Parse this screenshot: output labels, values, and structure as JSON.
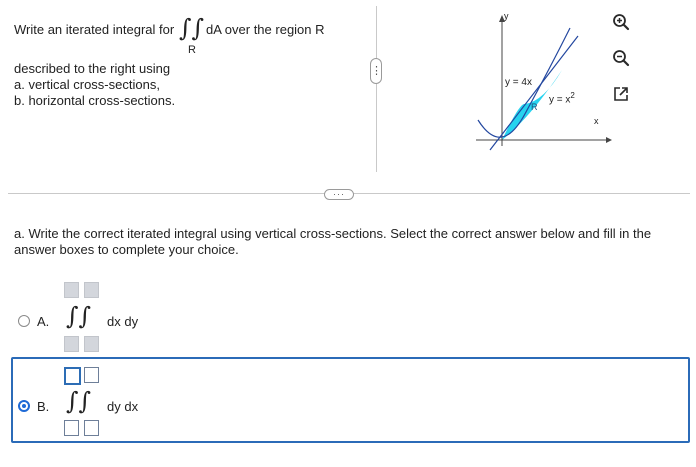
{
  "problem": {
    "intro": "Write an iterated integral for",
    "integrand": "dA over the region R",
    "region_sub": "R",
    "line2": "described to the right using",
    "line3": "a. vertical cross-sections,",
    "line4": "b. horizontal cross-sections."
  },
  "graph": {
    "y_axis": "y",
    "x_axis": "x",
    "line_label": "y = 4x",
    "curve_label_base": "y = x",
    "curve_label_exp": "2",
    "region_label": "R",
    "colors": {
      "region": "#27d3ef",
      "curve": "#23479f",
      "axis": "#444444"
    }
  },
  "tools": {
    "zoom_in_icon": "zoom-in-icon",
    "zoom_out_icon": "zoom-out-icon",
    "popout_icon": "external-link-icon"
  },
  "splitter": {
    "vertical_handle": "⋮",
    "horizontal_handle": "···"
  },
  "question": {
    "line1": "a. Write the correct iterated integral using vertical cross-sections. Select the correct answer below and fill in the",
    "line2": "answer boxes to complete your choice."
  },
  "options": [
    {
      "label": "A.",
      "differential": "dx dy",
      "selected": false
    },
    {
      "label": "B.",
      "differential": "dy dx",
      "selected": true
    }
  ]
}
